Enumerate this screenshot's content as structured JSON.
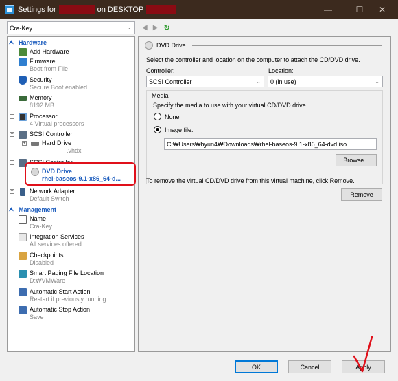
{
  "window": {
    "title_prefix": "Settings for",
    "title_middle": "on DESKTOP",
    "min_glyph": "—",
    "max_glyph": "☐",
    "close_glyph": "✕",
    "redaction_color": "#8a0b13"
  },
  "vm_selector": {
    "value": "Cra-Key"
  },
  "sections": {
    "hardware": "Hardware",
    "management": "Management"
  },
  "hardware_items": {
    "add_hardware": "Add Hardware",
    "firmware": "Firmware",
    "firmware_sub": "Boot from File",
    "security": "Security",
    "security_sub": "Secure Boot enabled",
    "memory": "Memory",
    "memory_sub": "8192 MB",
    "processor": "Processor",
    "processor_sub": "4 Virtual processors",
    "scsi1": "SCSI Controller",
    "hard_drive": "Hard Drive",
    "hard_drive_sub": ".vhdx",
    "scsi2": "SCSI Controller",
    "dvd_drive": "DVD Drive",
    "dvd_drive_sub": "rhel-baseos-9.1-x86_64-d...",
    "network": "Network Adapter",
    "network_sub": "Default Switch"
  },
  "management_items": {
    "name": "Name",
    "name_sub": "Cra-Key",
    "integration": "Integration Services",
    "integration_sub": "All services offered",
    "checkpoints": "Checkpoints",
    "checkpoints_sub": "Disabled",
    "paging": "Smart Paging File Location",
    "paging_sub": "D:₩VMWare",
    "auto_start": "Automatic Start Action",
    "auto_start_sub": "Restart if previously running",
    "auto_stop": "Automatic Stop Action",
    "auto_stop_sub": "Save"
  },
  "nav": {
    "back": "◀",
    "forward": "▶",
    "refresh": "↻"
  },
  "panel": {
    "header": "DVD Drive",
    "intro": "Select the controller and location on the computer to attach the CD/DVD drive.",
    "controller_label": "Controller:",
    "controller_value": "SCSI Controller",
    "location_label": "Location:",
    "location_value": "0 (in use)",
    "media_label": "Media",
    "media_desc": "Specify the media to use with your virtual CD/DVD drive.",
    "none_label": "None",
    "image_label": "Image file:",
    "image_path": "C:₩Users₩hyun4₩Downloads₩rhel-baseos-9.1-x86_64-dvd.iso",
    "browse": "Browse...",
    "remove_text": "To remove the virtual CD/DVD drive from this virtual machine, click Remove.",
    "remove_button": "Remove"
  },
  "footer": {
    "ok": "OK",
    "cancel": "Cancel",
    "apply": "Apply"
  },
  "colors": {
    "accent": "#1a5bbd",
    "annotation": "#e0101a"
  }
}
